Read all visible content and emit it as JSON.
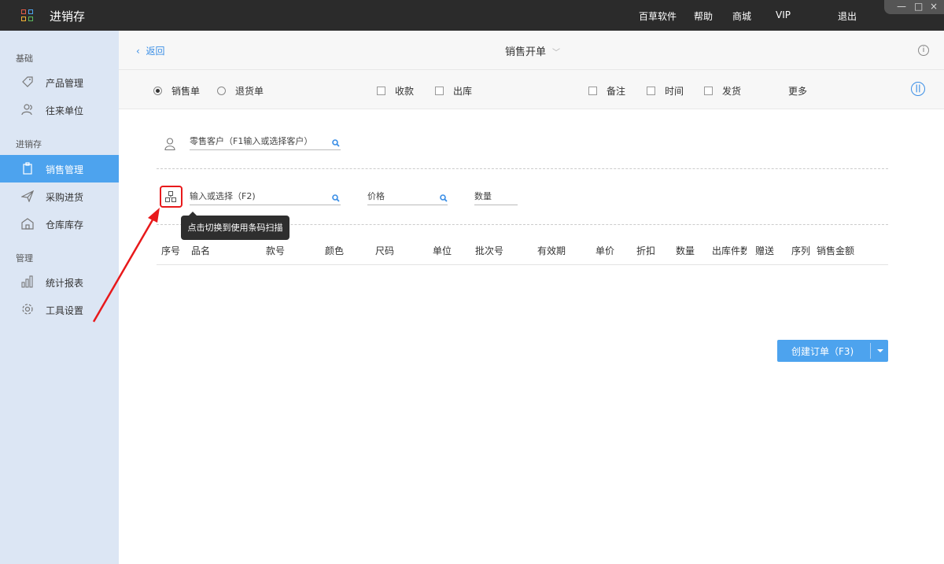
{
  "app": {
    "title": "进销存"
  },
  "topnav": [
    "百草软件",
    "帮助",
    "商城",
    "VIP",
    "退出"
  ],
  "window_controls": {
    "minimize": "—",
    "maximize": "□",
    "close": "×"
  },
  "sidebar": {
    "groups": [
      {
        "label": "基础",
        "items": [
          {
            "label": "产品管理",
            "icon": "tag-icon"
          },
          {
            "label": "往来单位",
            "icon": "contacts-icon"
          }
        ]
      },
      {
        "label": "进销存",
        "items": [
          {
            "label": "销售管理",
            "icon": "clipboard-icon",
            "active": true
          },
          {
            "label": "采购进货",
            "icon": "plane-icon"
          },
          {
            "label": "仓库库存",
            "icon": "warehouse-icon"
          }
        ]
      },
      {
        "label": "管理",
        "items": [
          {
            "label": "统计报表",
            "icon": "bar-chart-icon"
          },
          {
            "label": "工具设置",
            "icon": "gear-icon"
          }
        ]
      }
    ]
  },
  "header": {
    "back_label": "返回",
    "title": "销售开单"
  },
  "options": {
    "radios": [
      {
        "label": "销售单",
        "checked": true
      },
      {
        "label": "退货单",
        "checked": false
      }
    ],
    "checkboxes": [
      "收款",
      "出库",
      "备注",
      "时间",
      "发货"
    ],
    "more_label": "更多"
  },
  "customer": {
    "placeholder": "零售客户（F1输入或选择客户）"
  },
  "product": {
    "input_placeholder": "输入或选择（F2)",
    "price_placeholder": "价格",
    "qty_placeholder": "数量",
    "tooltip": "点击切换到使用条码扫描"
  },
  "table": {
    "columns": [
      "序号",
      "品名",
      "款号",
      "颜色",
      "尺码",
      "单位",
      "批次号",
      "有效期",
      "单价",
      "折扣",
      "数量",
      "出库件数",
      "赠送",
      "序列",
      "销售金额"
    ]
  },
  "create_button": {
    "label": "创建订单（F3)"
  },
  "colors": {
    "accent": "#4da3ee",
    "titlebar": "#2b2b2b",
    "sidebar": "#dce6f4",
    "highlight": "#e8191b"
  }
}
